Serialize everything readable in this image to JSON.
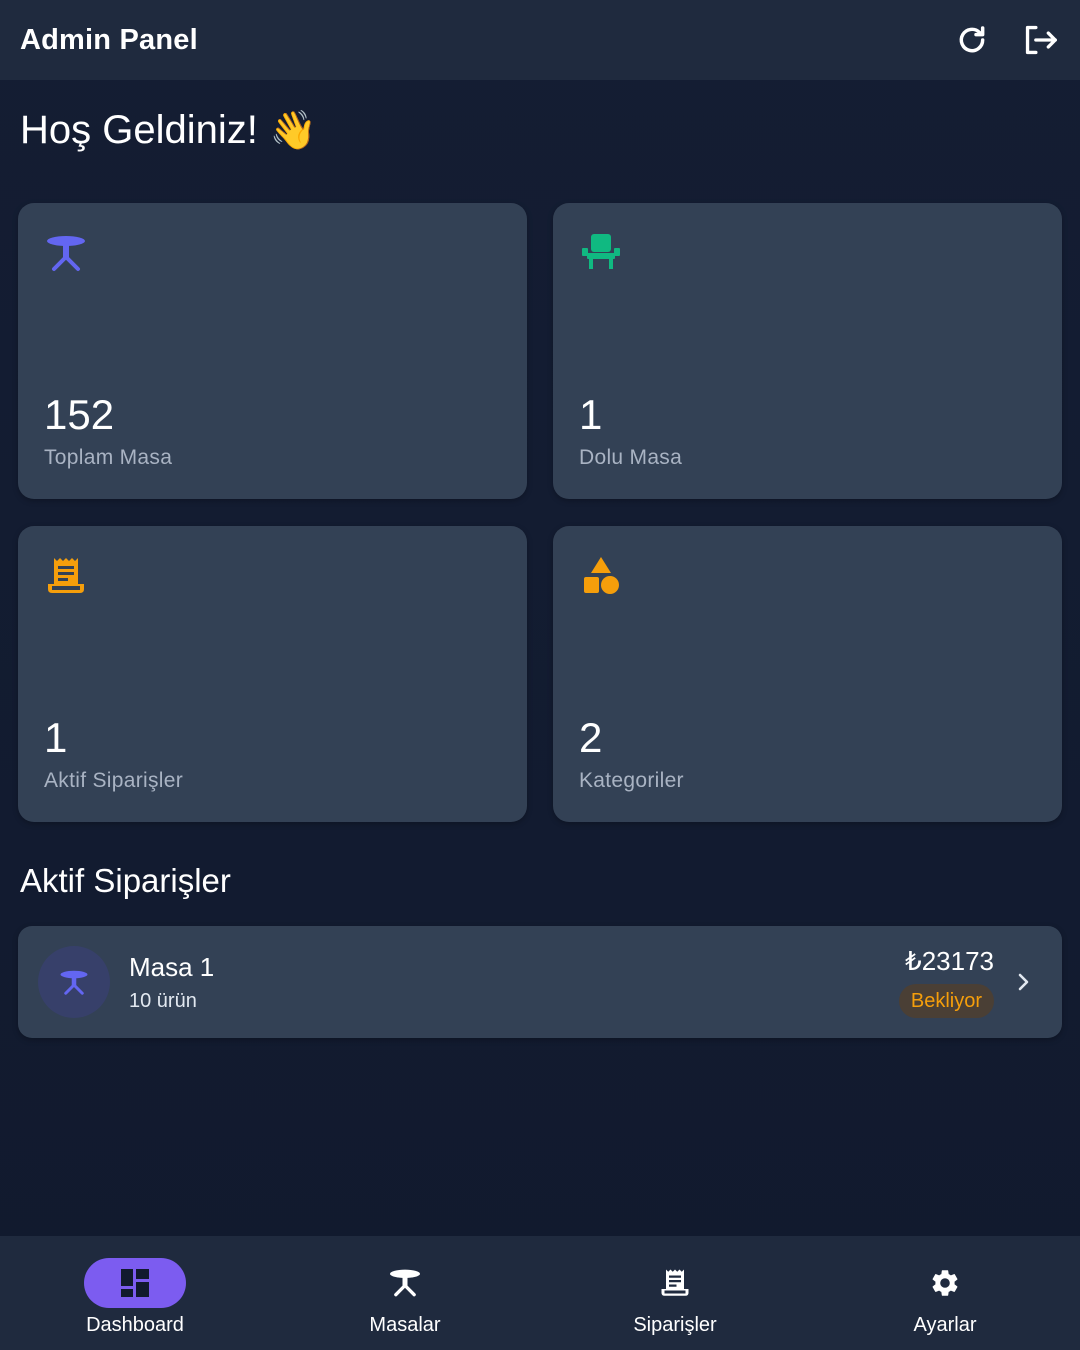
{
  "header": {
    "title": "Admin Panel",
    "actions": [
      {
        "icon": "refresh-icon"
      },
      {
        "icon": "logout-icon"
      }
    ]
  },
  "welcome": {
    "text": "Hoş Geldiniz!",
    "emoji": "👋"
  },
  "stats": [
    {
      "icon": "table-icon",
      "icon_color": "#6366f1",
      "value": "152",
      "label": "Toplam Masa"
    },
    {
      "icon": "chair-icon",
      "icon_color": "#10b981",
      "value": "1",
      "label": "Dolu Masa"
    },
    {
      "icon": "receipt-icon",
      "icon_color": "#f59e0b",
      "value": "1",
      "label": "Aktif Siparişler"
    },
    {
      "icon": "shapes-icon",
      "icon_color": "#f59e0b",
      "value": "2",
      "label": "Kategoriler"
    }
  ],
  "active_orders": {
    "title": "Aktif Siparişler",
    "items": [
      {
        "name": "Masa 1",
        "count": "10 ürün",
        "price": "₺23173",
        "status": "Bekliyor",
        "status_color": "#f59e0b"
      }
    ]
  },
  "bottom_nav": {
    "items": [
      {
        "label": "Dashboard",
        "icon": "dashboard-icon",
        "active": true
      },
      {
        "label": "Masalar",
        "icon": "table-icon",
        "active": false
      },
      {
        "label": "Siparişler",
        "icon": "receipt-icon",
        "active": false
      },
      {
        "label": "Ayarlar",
        "icon": "settings-icon",
        "active": false
      }
    ]
  },
  "colors": {
    "background": "#111a2e",
    "surface": "#334155",
    "bar": "#1f2a3e",
    "accent": "#7c5cf0"
  }
}
